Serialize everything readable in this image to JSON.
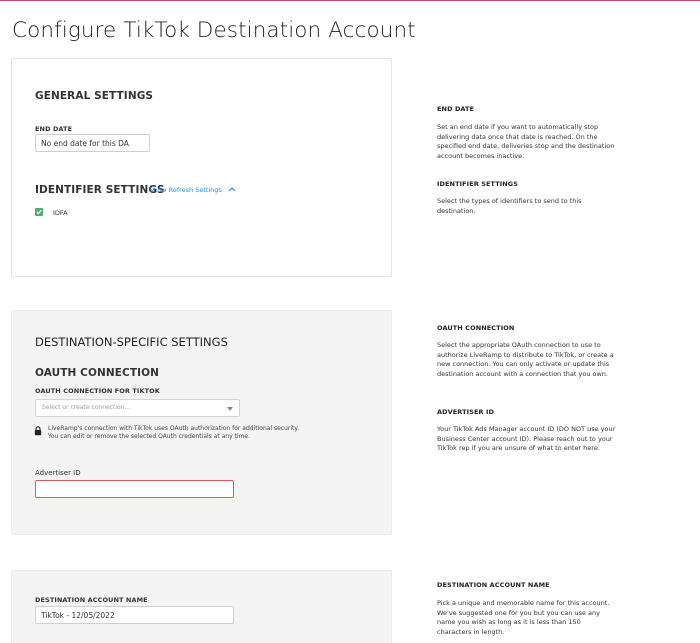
{
  "page": {
    "title": "Configure TikTok Destination Account"
  },
  "general": {
    "heading": "GENERAL SETTINGS",
    "end_date_label": "END DATE",
    "end_date_value": "No end date for this DA",
    "identifier_heading": "IDENTIFIER SETTINGS",
    "refresh_link": "Show Refresh Settings",
    "identifiers": [
      {
        "label": "IDFA",
        "checked": true
      }
    ]
  },
  "destination_specific": {
    "heading": "DESTINATION-SPECIFIC SETTINGS",
    "oauth_heading": "OAUTH CONNECTION",
    "oauth_label": "OAUTH CONNECTION FOR TIKTOK",
    "oauth_placeholder": "Select or create connection...",
    "oauth_note_line1": "LiveRamp's connection with TikTok uses OAuth authorization for additional security.",
    "oauth_note_line2": "You can edit or remove the selected OAuth credentials at any time.",
    "advertiser_label": "Advertiser ID",
    "advertiser_value": ""
  },
  "account_name": {
    "label": "DESTINATION ACCOUNT NAME",
    "value": "TikTok - 12/05/2022"
  },
  "help": {
    "end_date": {
      "heading": "END DATE",
      "text": "Set an end date if you want to automatically stop delivering data once that date is reached. On the specified end date, deliveries stop and the destination account becomes inactive."
    },
    "identifier": {
      "heading": "IDENTIFIER SETTINGS",
      "text": "Select the types of identifiers to send to this destination."
    },
    "oauth": {
      "heading": "OAUTH CONNECTION",
      "text": "Select the appropriate OAuth connection to use to authorize LiveRamp to distribute to TikTok, or create a new connection. You can only activate or update this destination account with a connection that you own."
    },
    "advertiser": {
      "heading": "ADVERTISER ID",
      "text": "Your TikTok Ads Manager account ID (DO NOT use your Business Center account ID). Please reach out to your TikTok rep if you are unsure of what to enter here."
    },
    "account_name": {
      "heading": "DESTINATION ACCOUNT NAME",
      "text": "Pick a unique and memorable name for this account. We've suggested one for you but you can use any name you wish as long as it is less than 150 characters in length."
    }
  },
  "colors": {
    "accent_line": "#c8426b",
    "link": "#2a8fd6",
    "checkbox": "#4caf72",
    "error_border": "#e05a5a"
  }
}
